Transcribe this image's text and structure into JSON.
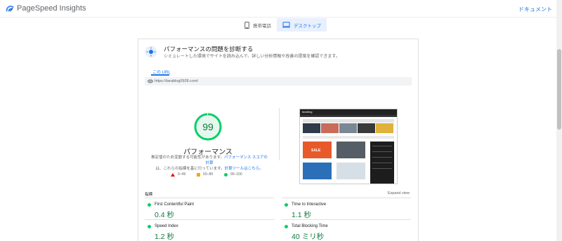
{
  "header": {
    "app_title": "PageSpeed Insights",
    "docs_link": "ドキュメント"
  },
  "device_tabs": [
    {
      "label": "携帯電話",
      "icon": "phone-icon",
      "active": false
    },
    {
      "label": "デスクトップ",
      "icon": "desktop-icon",
      "active": true
    }
  ],
  "diagnose": {
    "title": "パフォーマンスの問題を診断する",
    "subtitle": "シミュレートした環境でサイトを読み込んで、詳しい分析情報や改善の提案を確認できます。"
  },
  "url_tab": {
    "label": "この URL",
    "url": "https://tarablog0928.com/"
  },
  "score": {
    "value": "99",
    "value_fraction": 0.99,
    "label": "パフォーマンス",
    "desc_pre": "推定値のため変動する可能性があります。",
    "desc_link1": "パフォーマンス スコアの計算",
    "desc_mid": "は、これらの指標を基に行っています。",
    "desc_link2": "計算ツールはこちら。"
  },
  "legend": [
    {
      "range": "0–49",
      "shape": "triangle",
      "color": "#eb0f00"
    },
    {
      "range": "50–89",
      "shape": "square",
      "color": "#ffa400"
    },
    {
      "range": "90–100",
      "shape": "circle",
      "color": "#0cce6b"
    }
  ],
  "screenshot_preview": {
    "brand": "tarablog",
    "banner_text": "SALE"
  },
  "metrics": {
    "label": "指標",
    "expand": "Expand view",
    "items": [
      {
        "name": "First Contentful Paint",
        "value": "0.4 秒"
      },
      {
        "name": "Time to Interactive",
        "value": "1.1 秒"
      },
      {
        "name": "Speed Index",
        "value": "1.2 秒"
      },
      {
        "name": "Total Blocking Time",
        "value": "40 ミリ秒"
      }
    ]
  },
  "colors": {
    "accent": "#1a73e8",
    "pass": "#0cce6b",
    "pass_text": "#0c7a3e"
  }
}
